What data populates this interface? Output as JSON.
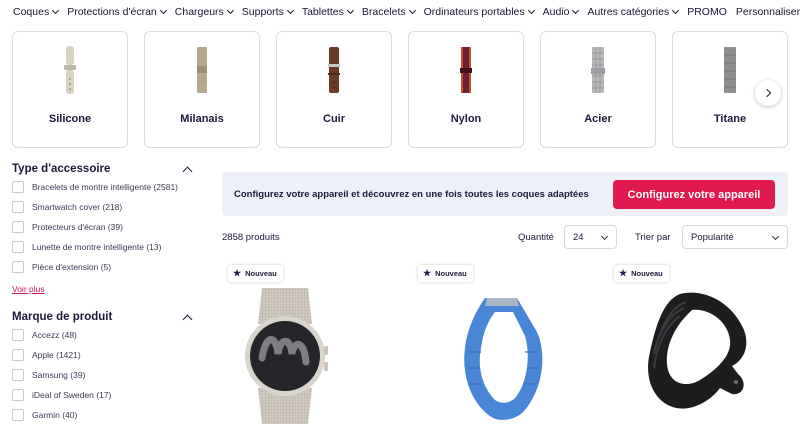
{
  "nav": {
    "items": [
      {
        "label": "Coques",
        "has_menu": true
      },
      {
        "label": "Protections d'écran",
        "has_menu": true
      },
      {
        "label": "Chargeurs",
        "has_menu": true
      },
      {
        "label": "Supports",
        "has_menu": true
      },
      {
        "label": "Tablettes",
        "has_menu": true
      },
      {
        "label": "Bracelets",
        "has_menu": true
      },
      {
        "label": "Ordinateurs portables",
        "has_menu": true
      },
      {
        "label": "Audio",
        "has_menu": true
      },
      {
        "label": "Autres catégories",
        "has_menu": true
      },
      {
        "label": "PROMO",
        "has_menu": false
      },
      {
        "label": "Personnaliser",
        "has_menu": false
      }
    ]
  },
  "materials": [
    {
      "label": "Silicone",
      "color": "#d9d2c4"
    },
    {
      "label": "Milanais",
      "color": "#b8a98e"
    },
    {
      "label": "Cuir",
      "color": "#6b3a24"
    },
    {
      "label": "Nylon",
      "color": "#6a2230"
    },
    {
      "label": "Acier",
      "color": "#b7b8bb"
    },
    {
      "label": "Titane",
      "color": "#8f8f90"
    }
  ],
  "filters": {
    "type": {
      "title": "Type d'accessoire",
      "options": [
        "Bracelets de montre intelligente (2581)",
        "Smartwatch cover (218)",
        "Protecteurs d'écran (39)",
        "Lunette de montre intelligente (13)",
        "Pièce d'extension (5)"
      ],
      "more": "Voir plus"
    },
    "brand": {
      "title": "Marque de produit",
      "options": [
        "Accezz (48)",
        "Apple (1421)",
        "Samsung (39)",
        "iDeal of Sweden (17)",
        "Garmin (40)"
      ]
    }
  },
  "banner": {
    "text": "Configurez votre appareil et découvrez en une fois toutes les coques adaptées",
    "button": "Configurez votre appareil"
  },
  "results": {
    "count": "2858 produits",
    "quantity_label": "Quantité",
    "quantity_value": "24",
    "sort_label": "Trier par",
    "sort_value": "Popularité"
  },
  "products": [
    {
      "badge": "Nouveau"
    },
    {
      "badge": "Nouveau"
    },
    {
      "badge": "Nouveau"
    }
  ],
  "colors": {
    "accent": "#e0194f",
    "link": "#d2194f",
    "banner_bg": "#eef0f8",
    "text": "#1a1a3a"
  }
}
